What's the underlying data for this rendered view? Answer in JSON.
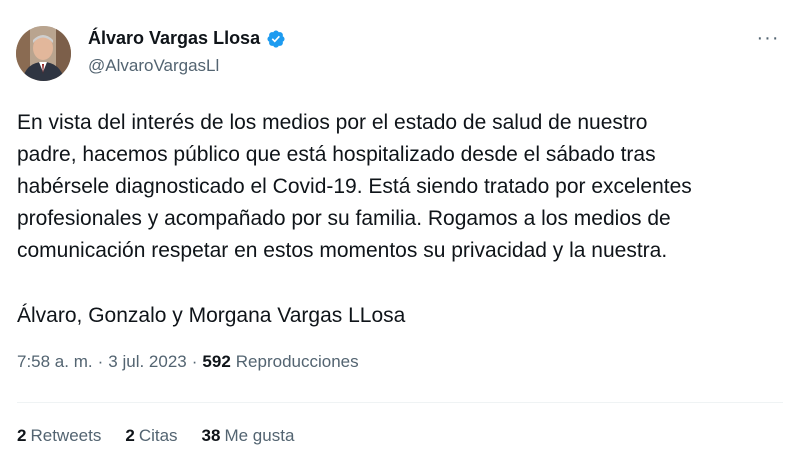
{
  "author": {
    "display_name": "Álvaro Vargas Llosa",
    "handle": "@AlvaroVargasLl",
    "verified": true,
    "badge_color": "#1d9bf0"
  },
  "more_icon": "more-horizontal-icon",
  "tweet": {
    "text": "En vista del interés de los medios por el estado de salud de nuestro\npadre, hacemos público que está hospitalizado desde el sábado tras\nhabérsele diagnosticado el Covid-19. Está siendo tratado por excelentes\nprofesionales y acompañado por su familia. Rogamos a los medios de\ncomunicación respetar en estos momentos su privacidad y la nuestra.",
    "signature": "Álvaro, Gonzalo y Morgana Vargas LLosa"
  },
  "meta": {
    "time": "7:58 a. m.",
    "separator": "·",
    "date": "3 jul. 2023",
    "views_count": "592",
    "views_label": "Reproducciones"
  },
  "stats": {
    "retweets_count": "2",
    "retweets_label": "Retweets",
    "quotes_count": "2",
    "quotes_label": "Citas",
    "likes_count": "38",
    "likes_label": "Me gusta"
  }
}
